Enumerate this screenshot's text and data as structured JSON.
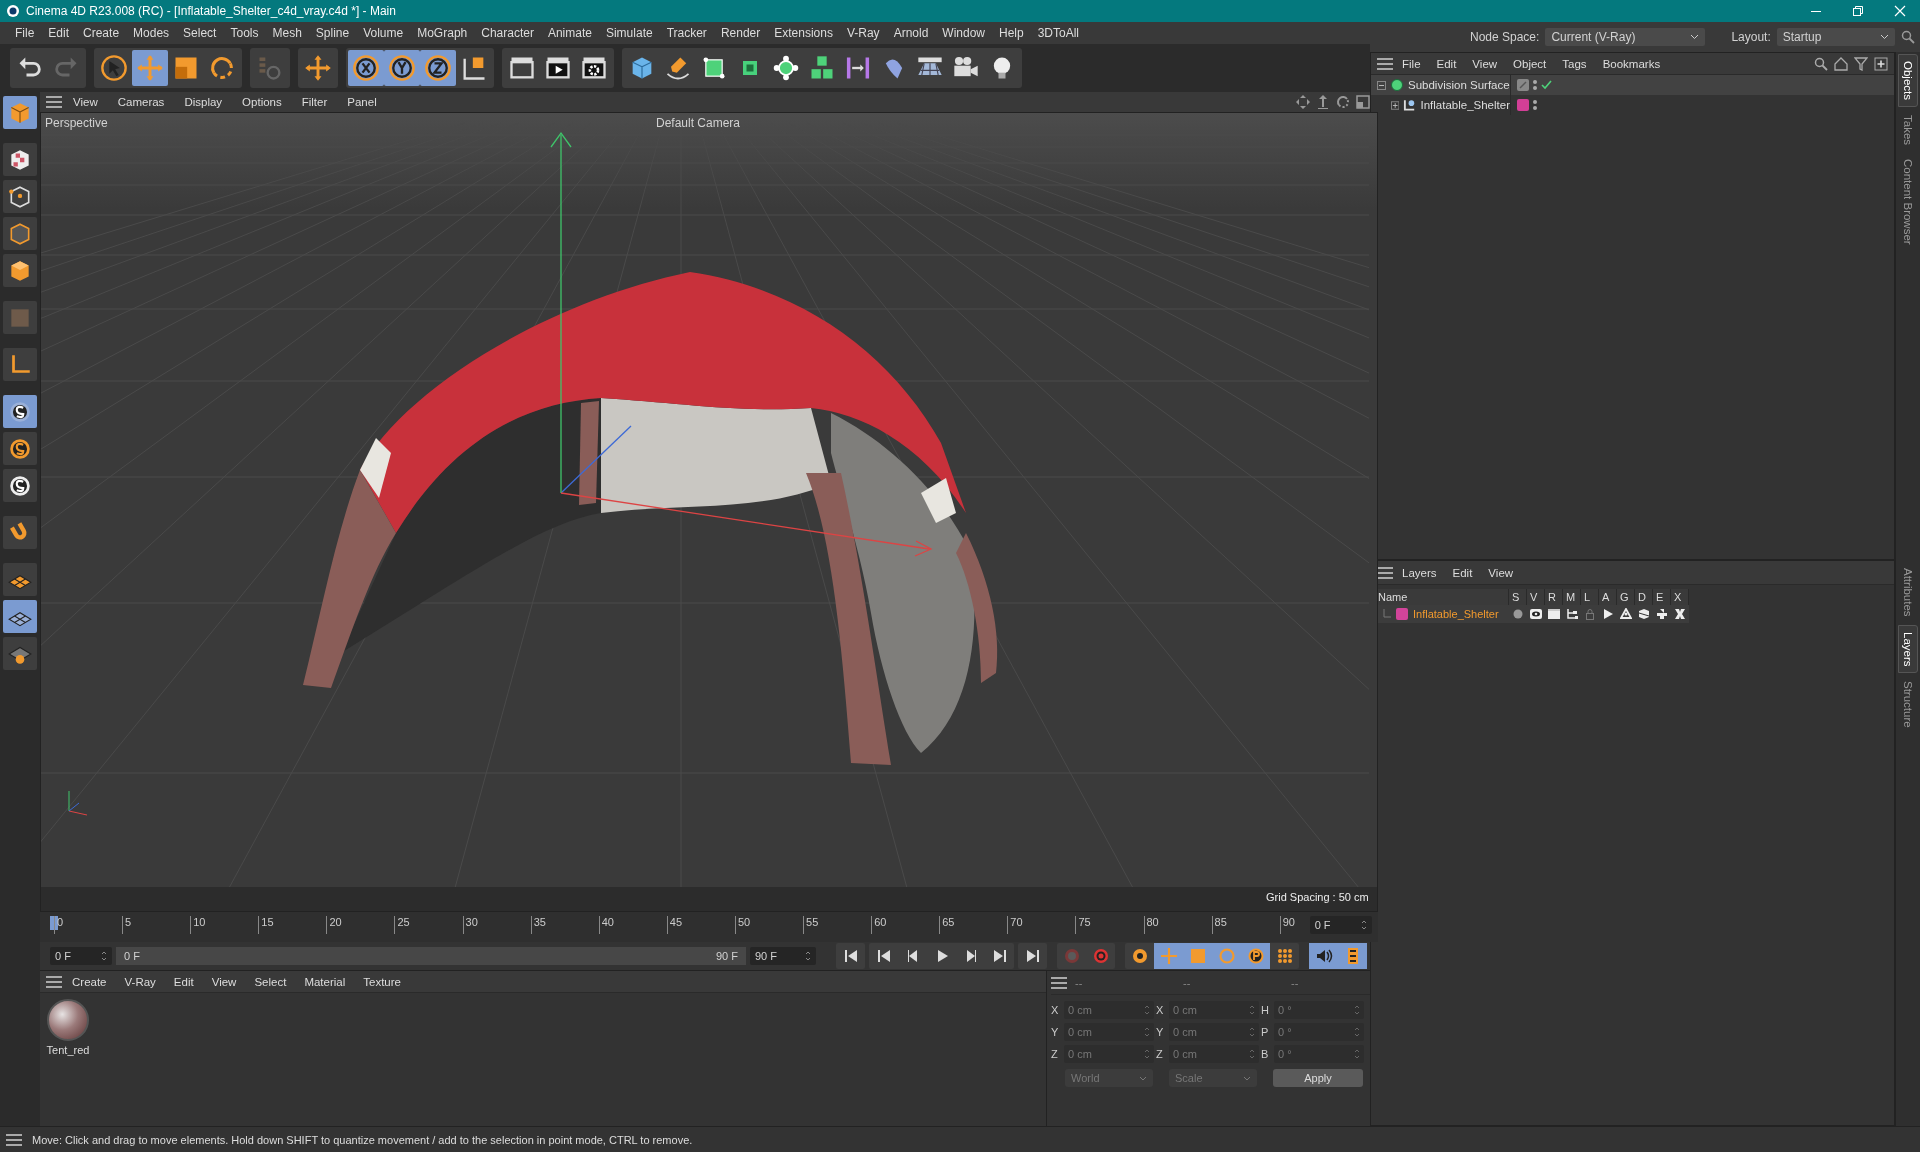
{
  "window": {
    "title": "Cinema 4D R23.008 (RC) - [Inflatable_Shelter_c4d_vray.c4d *] - Main"
  },
  "menu": [
    "File",
    "Edit",
    "Create",
    "Modes",
    "Select",
    "Tools",
    "Mesh",
    "Spline",
    "Volume",
    "MoGraph",
    "Character",
    "Animate",
    "Simulate",
    "Tracker",
    "Render",
    "Extensions",
    "V-Ray",
    "Arnold",
    "Window",
    "Help",
    "3DToAll"
  ],
  "node_space": {
    "label": "Node Space:",
    "value": "Current (V-Ray)"
  },
  "layout": {
    "label": "Layout:",
    "value": "Startup"
  },
  "viewport": {
    "menu": [
      "View",
      "Cameras",
      "Display",
      "Options",
      "Filter",
      "Panel"
    ],
    "view_name": "Perspective",
    "camera": "Default Camera",
    "grid_spacing": "Grid Spacing : 50 cm"
  },
  "objects_panel": {
    "menu": [
      "File",
      "Edit",
      "View",
      "Object",
      "Tags",
      "Bookmarks"
    ],
    "tree": [
      {
        "name": "Subdivision Surface",
        "expanded": true,
        "children": [
          {
            "name": "Inflatable_Shelter",
            "expanded": false,
            "color": "#d23f96"
          }
        ]
      }
    ]
  },
  "side_tabs_top": [
    {
      "label": "Objects",
      "selected": true
    },
    {
      "label": "Takes",
      "selected": false
    },
    {
      "label": "Content Browser",
      "selected": false
    }
  ],
  "layers_panel": {
    "menu": [
      "Layers",
      "Edit",
      "View"
    ],
    "columns": [
      "Name",
      "S",
      "V",
      "R",
      "M",
      "L",
      "A",
      "G",
      "D",
      "E",
      "X"
    ],
    "rows": [
      {
        "name": "Inflatable_Shelter",
        "color": "#d2449a"
      }
    ]
  },
  "side_tabs_bottom": [
    {
      "label": "Attributes",
      "selected": false
    },
    {
      "label": "Layers",
      "selected": true
    },
    {
      "label": "Structure",
      "selected": false
    }
  ],
  "timeline": {
    "ticks": [
      "0",
      "5",
      "10",
      "15",
      "20",
      "25",
      "30",
      "35",
      "40",
      "45",
      "50",
      "55",
      "60",
      "65",
      "70",
      "75",
      "80",
      "85",
      "90"
    ],
    "current_frame": "0 F",
    "start_frame": "0 F",
    "range_start": "0 F",
    "range_end": "90 F",
    "end_frame": "90 F"
  },
  "materials": {
    "menu": [
      "Create",
      "V-Ray",
      "Edit",
      "View",
      "Select",
      "Material",
      "Texture"
    ],
    "items": [
      {
        "name": "Tent_red"
      }
    ]
  },
  "coordinates": {
    "headers": [
      "--",
      "--",
      "--"
    ],
    "columns": [
      [
        {
          "axis": "X",
          "value": "0 cm"
        },
        {
          "axis": "Y",
          "value": "0 cm"
        },
        {
          "axis": "Z",
          "value": "0 cm"
        }
      ],
      [
        {
          "axis": "X",
          "value": "0 cm"
        },
        {
          "axis": "Y",
          "value": "0 cm"
        },
        {
          "axis": "Z",
          "value": "0 cm"
        }
      ],
      [
        {
          "axis": "H",
          "value": "0 °"
        },
        {
          "axis": "P",
          "value": "0 °"
        },
        {
          "axis": "B",
          "value": "0 °"
        }
      ]
    ],
    "dropdowns": [
      "World",
      "Scale"
    ],
    "apply": "Apply"
  },
  "status_bar": "Move: Click and drag to move elements. Hold down SHIFT to quantize movement / add to the selection in point mode, CTRL to remove."
}
